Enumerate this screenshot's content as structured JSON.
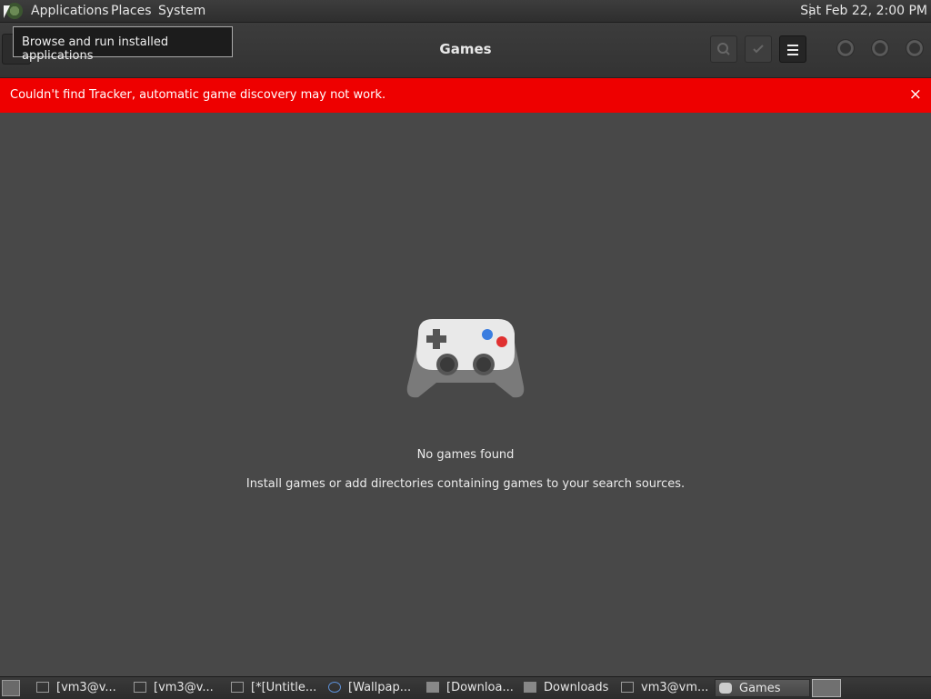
{
  "top_panel": {
    "menu": [
      "Applications",
      "Places",
      "System"
    ],
    "clock": "Sat Feb 22,  2:00 PM"
  },
  "tooltip": {
    "text": "Browse and run installed applications"
  },
  "header": {
    "title": "Games",
    "icons": {
      "search": "search-icon",
      "select": "checkmark-icon",
      "menu": "hamburger-menu-icon"
    }
  },
  "info_bar": {
    "message": "Couldn't find Tracker, automatic game discovery may not work.",
    "close": "×",
    "color": "#ee0000"
  },
  "empty_state": {
    "title": "No games found",
    "description": "Install games or add directories containing games to your search sources."
  },
  "taskbar": {
    "items": [
      {
        "label": "[vm3@v...",
        "icon": "terminal-icon"
      },
      {
        "label": "[vm3@v...",
        "icon": "terminal-icon"
      },
      {
        "label": "[*[Untitle...",
        "icon": "image-editor-icon"
      },
      {
        "label": "[Wallpap...",
        "icon": "browser-icon"
      },
      {
        "label": "[Downloa...",
        "icon": "folder-icon"
      },
      {
        "label": "Downloads",
        "icon": "folder-icon"
      },
      {
        "label": "vm3@vm...",
        "icon": "terminal-icon"
      },
      {
        "label": "Games",
        "icon": "gamepad-icon",
        "active": true
      }
    ]
  }
}
